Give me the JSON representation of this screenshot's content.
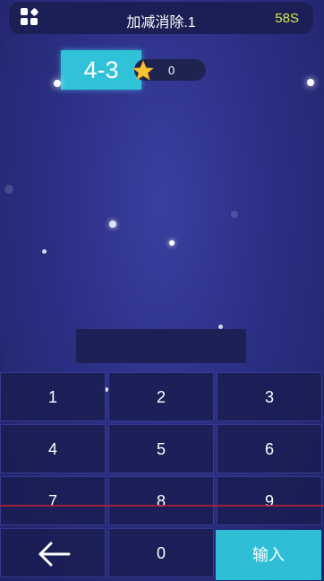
{
  "header": {
    "title": "加减消除.1",
    "timer": "58S"
  },
  "question": {
    "text": "4-3"
  },
  "score": {
    "value": "0"
  },
  "keypad": {
    "keys": [
      "1",
      "2",
      "3",
      "4",
      "5",
      "6",
      "7",
      "8",
      "9",
      "0"
    ],
    "enter_label": "输入"
  },
  "colors": {
    "accent": "#2fc2d8",
    "timer": "#d6e84a",
    "background": "#2d3188"
  },
  "icons": [
    "menu-icon",
    "star-icon",
    "back-arrow-icon"
  ]
}
